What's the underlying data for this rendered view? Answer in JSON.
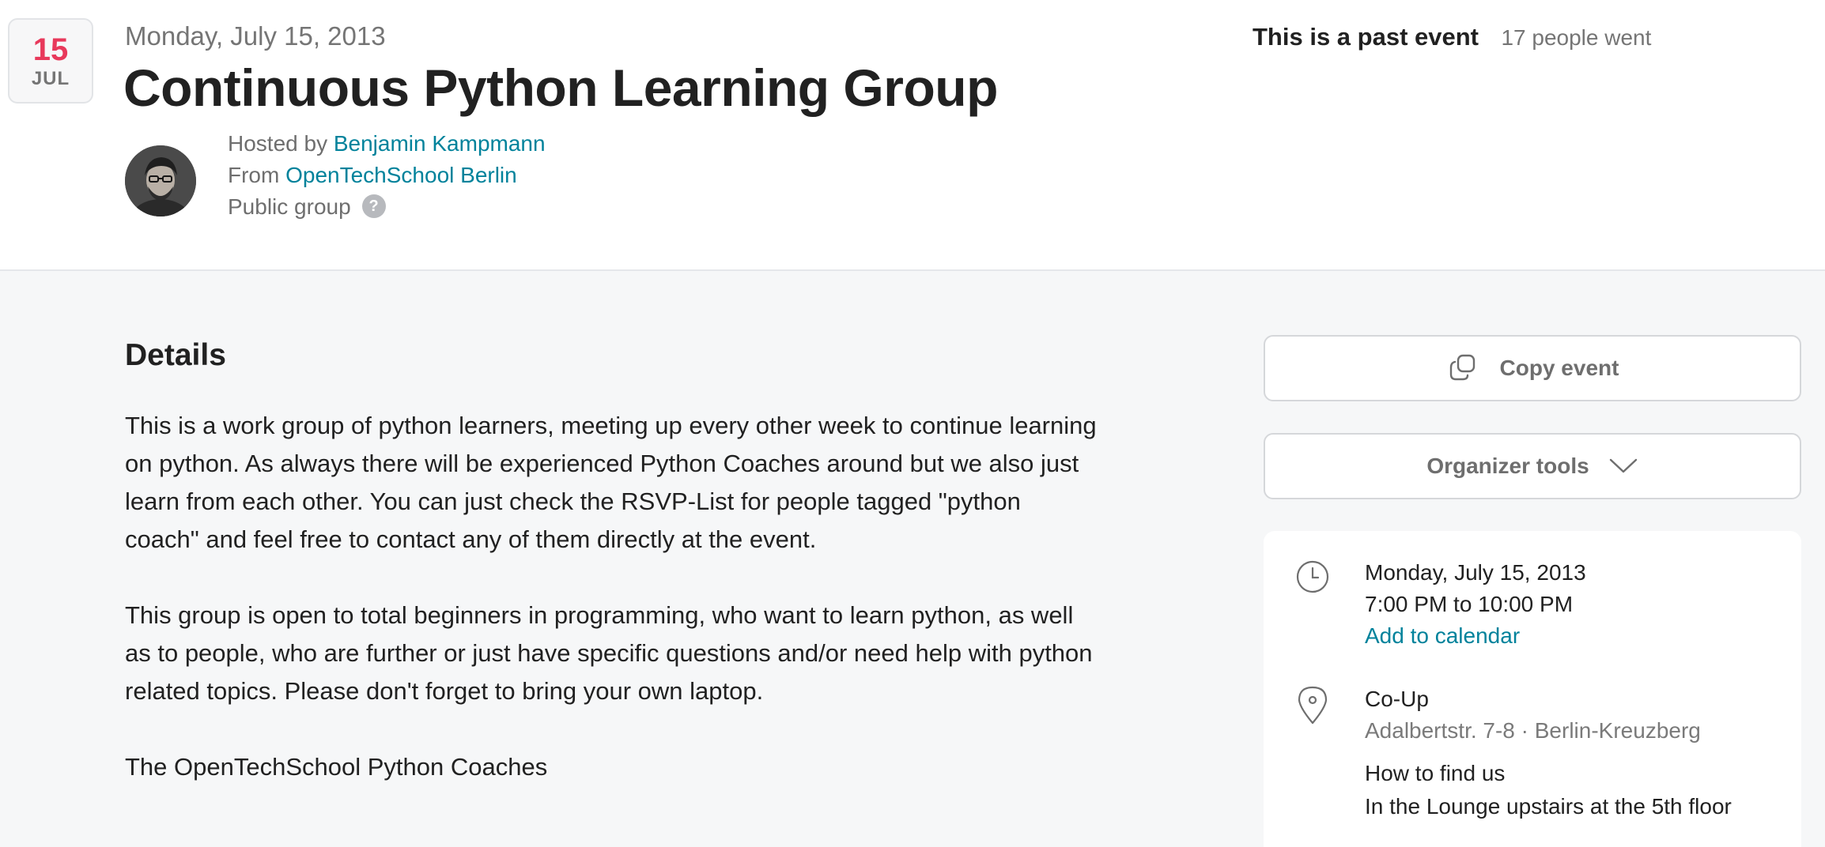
{
  "header": {
    "badge_day": "15",
    "badge_month": "JUL",
    "date": "Monday, July 15, 2013",
    "title": "Continuous Python Learning Group",
    "hosted_prefix": "Hosted by",
    "host_name": "Benjamin Kampmann",
    "from_prefix": "From",
    "group_name": "OpenTechSchool Berlin",
    "group_visibility": "Public group",
    "help_glyph": "?",
    "past_event_label": "This is a past event",
    "attendance": "17 people went"
  },
  "details": {
    "heading": "Details",
    "paragraphs": [
      "This is a work group of python learners, meeting up every other week to continue learning on python. As always there will be experienced Python Coaches around but we also just learn from each other. You can just check the RSVP-List for people tagged \"python coach\" and feel free to contact any of them directly at the event.",
      "This group is open to total beginners in programming, who want to learn python, as well as to people, who are further or just have specific questions and/or need help with python related topics. Please don't forget to bring your own laptop.",
      "The OpenTechSchool Python Coaches"
    ]
  },
  "sidebar": {
    "copy_button": "Copy event",
    "tools_button": "Organizer tools",
    "date": "Monday, July 15, 2013",
    "time": "7:00 PM to 10:00 PM",
    "add_calendar": "Add to calendar",
    "venue": "Co-Up",
    "address": "Adalbertstr. 7-8 · Berlin-Kreuzberg",
    "find_label": "How to find us",
    "find_text": "In the Lounge upstairs at the 5th floor"
  },
  "colors": {
    "badge_day": "#e8395b",
    "link": "#00829b",
    "main_background": "#f6f7f8"
  },
  "icons": [
    "copy-icon",
    "chevron-down-icon",
    "clock-icon",
    "map-pin-icon",
    "help-icon"
  ]
}
